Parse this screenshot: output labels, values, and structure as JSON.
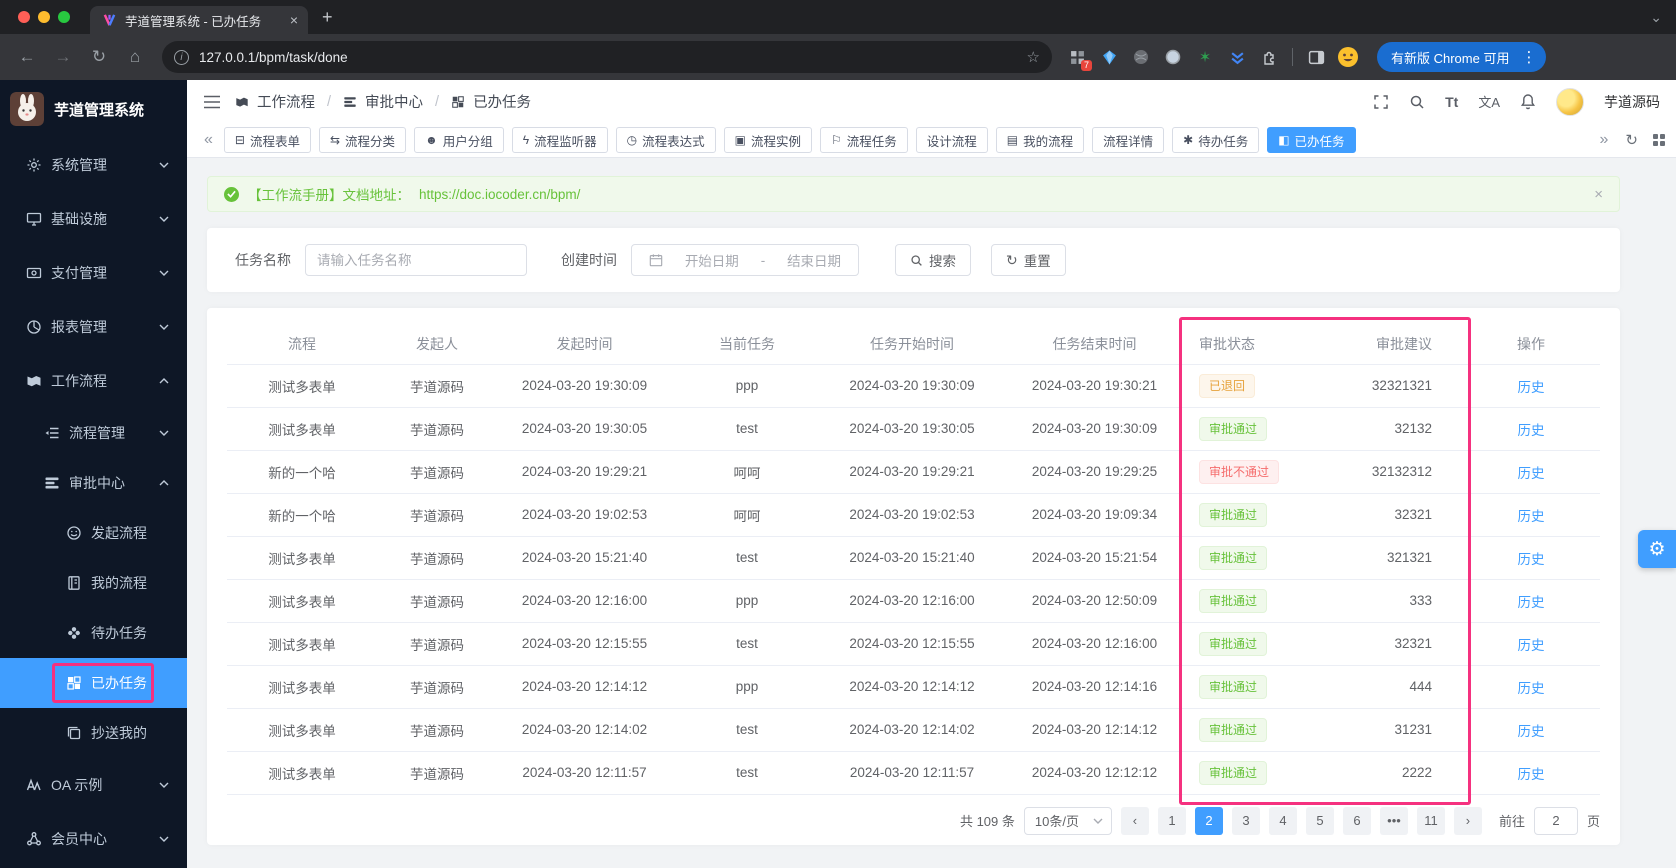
{
  "browser": {
    "tab_title": "芋道管理系统 - 已办任务",
    "url": "127.0.0.1/bpm/task/done",
    "update_text": "有新版 Chrome 可用",
    "ext_badge": "7"
  },
  "glyphs": {
    "back": "←",
    "forward": "→",
    "reload": "↻",
    "home": "⌂",
    "info": "i",
    "star": "☆",
    "more_v": "⋮",
    "chev_down": "⌄",
    "close": "×",
    "plus": "+",
    "tab_prev": "«",
    "tab_next": "»",
    "gear": "⚙",
    "green_star": "✶"
  },
  "header": {
    "breadcrumb": [
      "工作流程",
      "审批中心",
      "已办任务"
    ],
    "font_icon": "Tt",
    "lang_icon": "文A",
    "username": "芋道源码"
  },
  "sidebar": {
    "title": "芋道管理系统",
    "items": [
      {
        "label": "系统管理"
      },
      {
        "label": "基础设施"
      },
      {
        "label": "支付管理"
      },
      {
        "label": "报表管理"
      },
      {
        "label": "工作流程"
      },
      {
        "label": "流程管理"
      },
      {
        "label": "审批中心"
      },
      {
        "label": "发起流程"
      },
      {
        "label": "我的流程"
      },
      {
        "label": "待办任务"
      },
      {
        "label": "已办任务"
      },
      {
        "label": "抄送我的"
      },
      {
        "label": "OA 示例"
      },
      {
        "label": "会员中心"
      }
    ]
  },
  "tabs": [
    {
      "icon": "⊟",
      "label": "流程表单",
      "state": ""
    },
    {
      "icon": "⇆",
      "label": "流程分类",
      "state": ""
    },
    {
      "icon": "☻",
      "label": "用户分组",
      "state": ""
    },
    {
      "icon": "ϟ",
      "label": "流程监听器",
      "state": ""
    },
    {
      "icon": "◷",
      "label": "流程表达式",
      "state": ""
    },
    {
      "icon": "▣",
      "label": "流程实例",
      "state": ""
    },
    {
      "icon": "⚐",
      "label": "流程任务",
      "state": ""
    },
    {
      "icon": "",
      "label": "设计流程",
      "state": ""
    },
    {
      "icon": "▤",
      "label": "我的流程",
      "state": ""
    },
    {
      "icon": "",
      "label": "流程详情",
      "state": ""
    },
    {
      "icon": "✱",
      "label": "待办任务",
      "state": ""
    },
    {
      "icon": "◧",
      "label": "已办任务",
      "state": "active"
    }
  ],
  "banner": {
    "text": "【工作流手册】文档地址：",
    "link": "https://doc.iocoder.cn/bpm/"
  },
  "search": {
    "name_label": "任务名称",
    "name_placeholder": "请输入任务名称",
    "time_label": "创建时间",
    "start_placeholder": "开始日期",
    "sep": "-",
    "end_placeholder": "结束日期",
    "search_label": "搜索",
    "reset_label": "重置"
  },
  "table": {
    "columns": [
      "流程",
      "发起人",
      "发起时间",
      "当前任务",
      "任务开始时间",
      "任务结束时间",
      "审批状态",
      "审批建议",
      "操作"
    ],
    "action_label": "历史",
    "rows": [
      {
        "flow": "测试多表单",
        "starter": "芋道源码",
        "start_time": "2024-03-20 19:30:09",
        "task": "ppp",
        "task_start": "2024-03-20 19:30:09",
        "task_end": "2024-03-20 19:30:21",
        "status": "已退回",
        "status_type": "warning",
        "advice": "32321321"
      },
      {
        "flow": "测试多表单",
        "starter": "芋道源码",
        "start_time": "2024-03-20 19:30:05",
        "task": "test",
        "task_start": "2024-03-20 19:30:05",
        "task_end": "2024-03-20 19:30:09",
        "status": "审批通过",
        "status_type": "success",
        "advice": "32132"
      },
      {
        "flow": "新的一个哈",
        "starter": "芋道源码",
        "start_time": "2024-03-20 19:29:21",
        "task": "呵呵",
        "task_start": "2024-03-20 19:29:21",
        "task_end": "2024-03-20 19:29:25",
        "status": "审批不通过",
        "status_type": "danger",
        "advice": "32132312"
      },
      {
        "flow": "新的一个哈",
        "starter": "芋道源码",
        "start_time": "2024-03-20 19:02:53",
        "task": "呵呵",
        "task_start": "2024-03-20 19:02:53",
        "task_end": "2024-03-20 19:09:34",
        "status": "审批通过",
        "status_type": "success",
        "advice": "32321"
      },
      {
        "flow": "测试多表单",
        "starter": "芋道源码",
        "start_time": "2024-03-20 15:21:40",
        "task": "test",
        "task_start": "2024-03-20 15:21:40",
        "task_end": "2024-03-20 15:21:54",
        "status": "审批通过",
        "status_type": "success",
        "advice": "321321"
      },
      {
        "flow": "测试多表单",
        "starter": "芋道源码",
        "start_time": "2024-03-20 12:16:00",
        "task": "ppp",
        "task_start": "2024-03-20 12:16:00",
        "task_end": "2024-03-20 12:50:09",
        "status": "审批通过",
        "status_type": "success",
        "advice": "333"
      },
      {
        "flow": "测试多表单",
        "starter": "芋道源码",
        "start_time": "2024-03-20 12:15:55",
        "task": "test",
        "task_start": "2024-03-20 12:15:55",
        "task_end": "2024-03-20 12:16:00",
        "status": "审批通过",
        "status_type": "success",
        "advice": "32321"
      },
      {
        "flow": "测试多表单",
        "starter": "芋道源码",
        "start_time": "2024-03-20 12:14:12",
        "task": "ppp",
        "task_start": "2024-03-20 12:14:12",
        "task_end": "2024-03-20 12:14:16",
        "status": "审批通过",
        "status_type": "success",
        "advice": "444"
      },
      {
        "flow": "测试多表单",
        "starter": "芋道源码",
        "start_time": "2024-03-20 12:14:02",
        "task": "test",
        "task_start": "2024-03-20 12:14:02",
        "task_end": "2024-03-20 12:14:12",
        "status": "审批通过",
        "status_type": "success",
        "advice": "31231"
      },
      {
        "flow": "测试多表单",
        "starter": "芋道源码",
        "start_time": "2024-03-20 12:11:57",
        "task": "test",
        "task_start": "2024-03-20 12:11:57",
        "task_end": "2024-03-20 12:12:12",
        "status": "审批通过",
        "status_type": "success",
        "advice": "2222"
      }
    ]
  },
  "pagination": {
    "total": "共 109 条",
    "page_size": "10条/页",
    "prev": "‹",
    "next": "›",
    "pages": [
      {
        "label": "1",
        "state": ""
      },
      {
        "label": "2",
        "state": "active"
      },
      {
        "label": "3",
        "state": ""
      },
      {
        "label": "4",
        "state": ""
      },
      {
        "label": "5",
        "state": ""
      },
      {
        "label": "6",
        "state": ""
      },
      {
        "label": "•••",
        "state": ""
      },
      {
        "label": "11",
        "state": ""
      }
    ],
    "goto_label": "前往",
    "goto_value": "2",
    "unit": "页"
  },
  "colors": {
    "accent": "#409eff",
    "success": "#67c23a",
    "warning": "#e6a23c",
    "danger": "#f56c6c",
    "annotation": "#f5317f",
    "sidebar_bg": "#0e1726"
  }
}
